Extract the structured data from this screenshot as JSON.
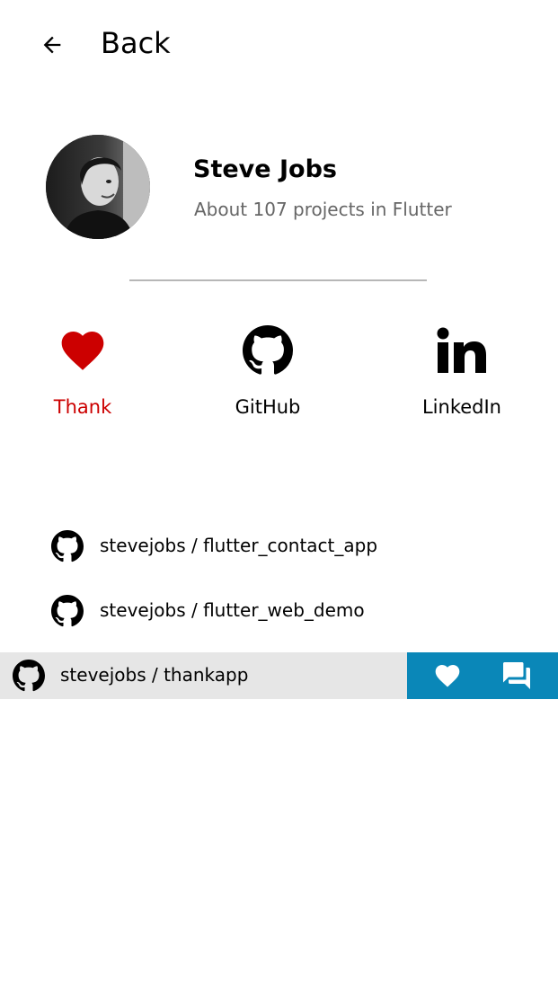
{
  "header": {
    "back_label": "Back"
  },
  "profile": {
    "name": "Steve Jobs",
    "subtitle": "About 107 projects in Flutter"
  },
  "actions": [
    {
      "label": "Thank",
      "icon": "heart-icon",
      "color": "#cc0000"
    },
    {
      "label": "GitHub",
      "icon": "github-icon",
      "color": "#000000"
    },
    {
      "label": "LinkedIn",
      "icon": "linkedin-icon",
      "color": "#000000"
    }
  ],
  "repos": [
    {
      "label": "stevejobs / flutter_contact_app",
      "icon": "github-icon"
    },
    {
      "label": "stevejobs / flutter_web_demo",
      "icon": "github-icon"
    },
    {
      "label": "stevejobs / thankapp",
      "icon": "github-icon"
    }
  ],
  "slide_actions": [
    {
      "icon": "heart-icon"
    },
    {
      "icon": "chat-icon"
    }
  ],
  "colors": {
    "accent": "#0a87b8",
    "thank": "#cc0000",
    "row_highlight": "#e6e6e6"
  }
}
